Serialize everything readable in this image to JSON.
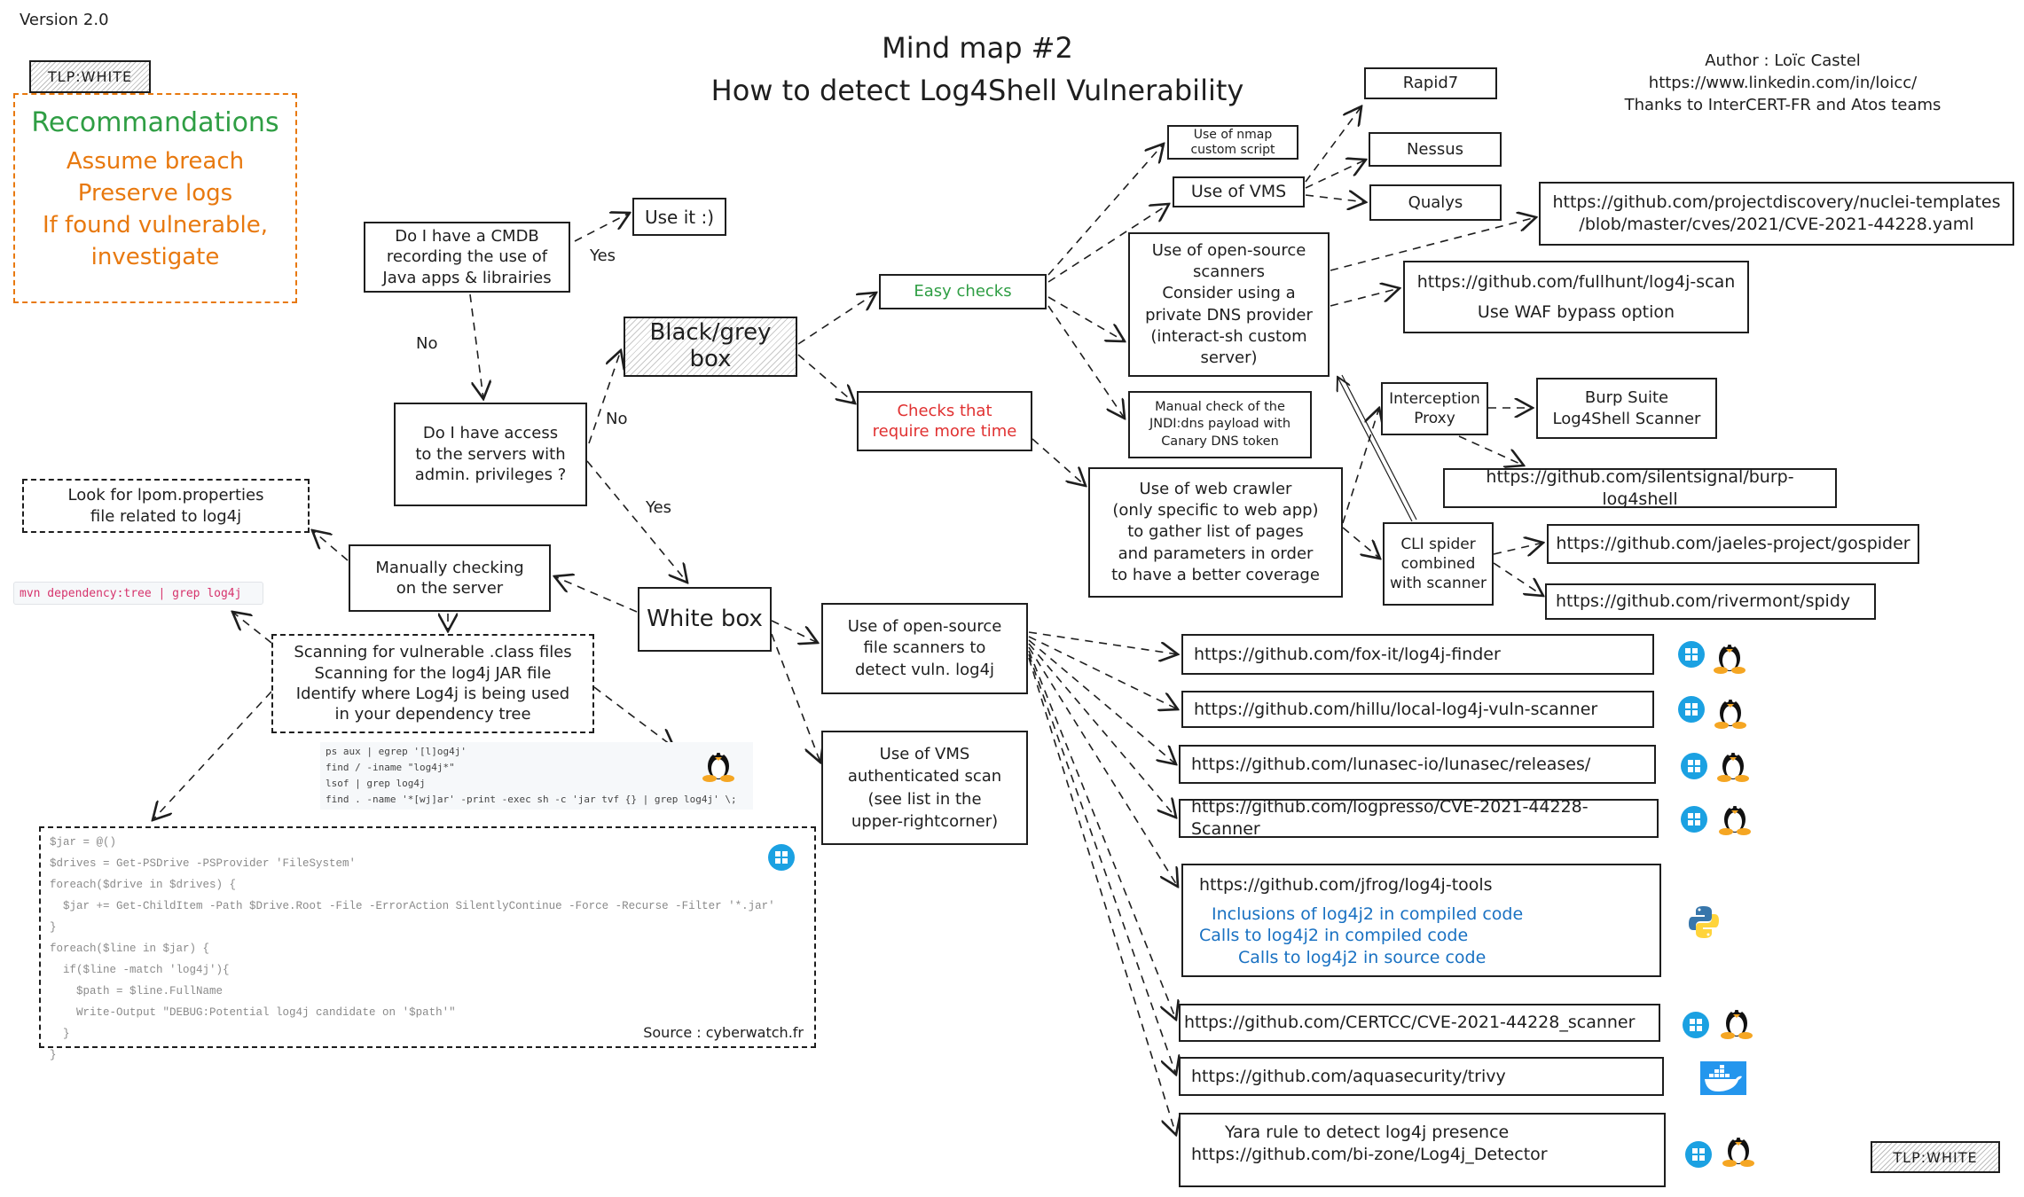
{
  "header": {
    "version": "Version 2.0",
    "tlp_top": "TLP:WHITE",
    "tlp_bottom": "TLP:WHITE",
    "title_line1": "Mind map #2",
    "title_line2": "How to detect Log4Shell Vulnerability",
    "author": "Author : Loïc Castel",
    "author_link": "https://www.linkedin.com/in/loicc/",
    "thanks": "Thanks to InterCERT-FR and Atos teams"
  },
  "recommendations": {
    "title": "Recommandations",
    "items": [
      "Assume breach",
      "Preserve logs",
      "If found vulnerable,",
      "investigate"
    ]
  },
  "decisions": {
    "cmdb": [
      "Do I have a CMDB",
      "recording the use of",
      "Java apps & librairies"
    ],
    "use_it": "Use it :)",
    "yes1": "Yes",
    "no1": "No",
    "access": [
      "Do I have access",
      "to the servers with",
      "admin. privileges ?"
    ],
    "no2": "No",
    "yes2": "Yes"
  },
  "black_grey": {
    "title": [
      "Black/grey",
      "box"
    ],
    "easy_checks": "Easy checks",
    "more_time": [
      "Checks that",
      "require more time"
    ],
    "nmap": [
      "Use of nmap",
      "custom script"
    ],
    "vms": "Use of VMS",
    "vms_list": [
      "Rapid7",
      "Nessus",
      "Qualys"
    ],
    "os_scanners": [
      "Use of open-source",
      "scanners",
      "Consider using a",
      "private DNS provider",
      "(interact-sh custom",
      "server)"
    ],
    "nuclei": [
      "https://github.com/projectdiscovery/nuclei-templates",
      "/blob/master/cves/2021/CVE-2021-44228.yaml"
    ],
    "fullhunt": [
      "https://github.com/fullhunt/log4j-scan",
      "Use WAF bypass option"
    ],
    "manual_jndi": [
      "Manual check of the",
      "JNDI:dns payload with",
      "Canary DNS token"
    ],
    "web_crawler": [
      "Use of web crawler",
      "(only specific to web app)",
      "to gather list of pages",
      "and parameters in order",
      "to have a better coverage"
    ],
    "interception_proxy": [
      "Interception",
      "Proxy"
    ],
    "burp": [
      "Burp Suite",
      "Log4Shell Scanner"
    ],
    "silentsignal": "https://github.com/silentsignal/burp-log4shell",
    "cli_spider": [
      "CLI spider",
      "combined",
      "with scanner"
    ],
    "gospider": "https://github.com/jaeles-project/gospider",
    "spidy": "https://github.com/rivermont/spidy"
  },
  "white_box": {
    "title": "White box",
    "manual": [
      "Manually checking",
      "on the server"
    ],
    "pom": [
      "Look for lpom.properties",
      "file related to log4j"
    ],
    "mvn_cmd": "mvn dependency:tree | grep log4j",
    "scanning": [
      "Scanning for vulnerable .class files",
      "Scanning for the log4j JAR file",
      "Identify where Log4j is being used",
      "in your dependency tree"
    ],
    "linux_cmds": [
      "ps aux | egrep '[l]og4j'",
      "find / -iname \"log4j*\"",
      "lsof | grep log4j",
      "find . -name '*[wj]ar' -print -exec sh -c 'jar tvf {} | grep log4j' \\;"
    ],
    "powershell": [
      "$jar = @()",
      "$drives = Get-PSDrive -PSProvider 'FileSystem'",
      "foreach($drive in $drives) {",
      "  $jar += Get-ChildItem -Path $Drive.Root -File -ErrorAction SilentlyContinue -Force -Recurse -Filter '*.jar'",
      "}",
      "foreach($line in $jar) {",
      "  if($line -match 'log4j'){",
      "    $path = $line.FullName",
      "    Write-Output \"DEBUG:Potential log4j candidate on '$path'\"",
      "  }",
      "}"
    ],
    "source": "Source : cyberwatch.fr",
    "file_scanners": [
      "Use of open-source",
      "file scanners to",
      "detect vuln. log4j"
    ],
    "vms_auth": [
      "Use of VMS",
      "authenticated scan",
      "(see list in the",
      "upper-rightcorner)"
    ],
    "tools": [
      {
        "lines": [
          "https://github.com/fox-it/log4j-finder"
        ],
        "os": [
          "windows-icon",
          "linux-icon"
        ]
      },
      {
        "lines": [
          "https://github.com/hillu/local-log4j-vuln-scanner"
        ],
        "os": [
          "windows-icon",
          "linux-icon"
        ]
      },
      {
        "lines": [
          "https://github.com/lunasec-io/lunasec/releases/"
        ],
        "os": [
          "windows-icon",
          "linux-icon"
        ]
      },
      {
        "lines": [
          "https://github.com/logpresso/CVE-2021-44228-Scanner"
        ],
        "os": [
          "windows-icon",
          "linux-icon"
        ]
      },
      {
        "lines": [
          "https://github.com/jfrog/log4j-tools"
        ],
        "sub": [
          "Inclusions of log4j2 in compiled code",
          "Calls to log4j2 in compiled code",
          "Calls to log4j2 in source code"
        ],
        "os": [
          "python-icon"
        ]
      },
      {
        "lines": [
          "https://github.com/CERTCC/CVE-2021-44228_scanner"
        ],
        "os": [
          "windows-icon",
          "linux-icon"
        ]
      },
      {
        "lines": [
          "https://github.com/aquasecurity/trivy"
        ],
        "os": [
          "docker-icon"
        ]
      },
      {
        "lines": [
          "Yara rule to detect log4j presence",
          "https://github.com/bi-zone/Log4j_Detector"
        ],
        "os": [
          "windows-icon",
          "linux-icon"
        ]
      }
    ]
  },
  "colors": {
    "green": "#2f9e44",
    "orange": "#e8790f",
    "red": "#e03131",
    "blue": "#1971c2",
    "windows": "#1ba1e2",
    "docker": "#2496ed"
  }
}
